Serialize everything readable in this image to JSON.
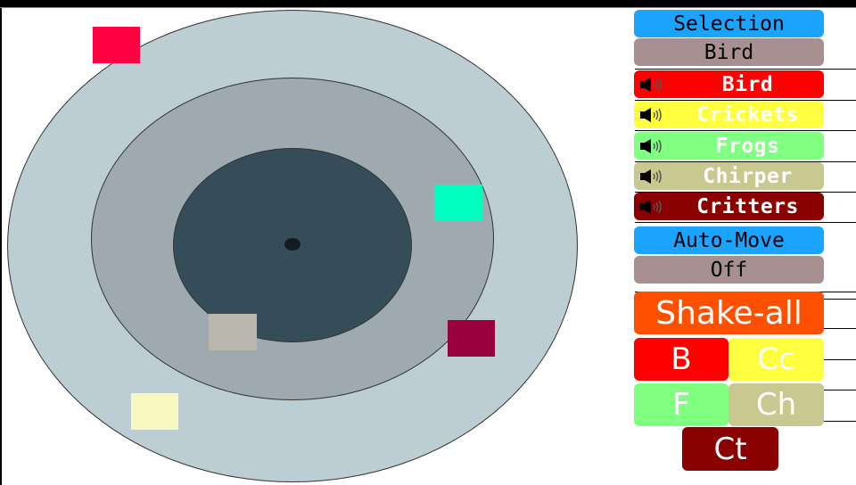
{
  "colors": {
    "outer_ring": "#bccdd4",
    "middle_ring": "#9eaab0",
    "inner_ring": "#354d59",
    "label_blue": "#1aa3ff",
    "value_taupe": "#a89090"
  },
  "arena": {
    "critters": [
      {
        "name": "red-square",
        "color": "#ff0040"
      },
      {
        "name": "teal-square",
        "color": "#00ffc0"
      },
      {
        "name": "grey-square",
        "color": "#b8b8ac"
      },
      {
        "name": "maroon-square",
        "color": "#980040"
      },
      {
        "name": "cream-square",
        "color": "#f8f8c0"
      }
    ]
  },
  "panel": {
    "selection_label": "Selection",
    "selection_value": "Bird",
    "sounds": [
      {
        "label": "Bird",
        "color": "#ff0000",
        "icon": "speaker-icon"
      },
      {
        "label": "Crickets",
        "color": "#ffff40",
        "icon": "speaker-icon"
      },
      {
        "label": "Frogs",
        "color": "#80ff80",
        "icon": "speaker-icon"
      },
      {
        "label": "Chirper",
        "color": "#c8c890",
        "icon": "speaker-icon"
      },
      {
        "label": "Critters",
        "color": "#8b0000",
        "icon": "speaker-icon"
      }
    ],
    "automove_label": "Auto-Move",
    "automove_value": "Off",
    "shake_all": "Shake-all",
    "quick": {
      "b": "B",
      "cc": "Cc",
      "f": "F",
      "ch": "Ch",
      "ct": "Ct"
    }
  }
}
